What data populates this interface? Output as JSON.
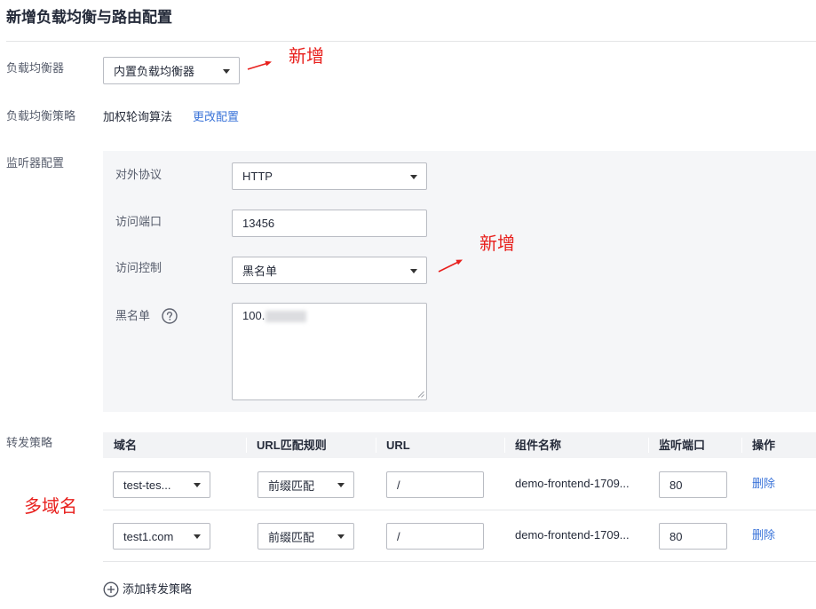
{
  "title": "新增负载均衡与路由配置",
  "load_balancer": {
    "label": "负载均衡器",
    "value": "内置负载均衡器"
  },
  "balancing_strategy": {
    "label": "负载均衡策略",
    "value": "加权轮询算法",
    "change_link": "更改配置"
  },
  "listener": {
    "label": "监听器配置",
    "protocol": {
      "label": "对外协议",
      "value": "HTTP"
    },
    "port": {
      "label": "访问端口",
      "value": "13456"
    },
    "access_control": {
      "label": "访问控制",
      "value": "黑名单"
    },
    "blacklist": {
      "label": "黑名单",
      "value": "100.",
      "help_icon": "question-circle-icon"
    }
  },
  "forwarding": {
    "label": "转发策略",
    "columns": {
      "domain": "域名",
      "match_rule": "URL匹配规则",
      "url": "URL",
      "component": "组件名称",
      "port": "监听端口",
      "action": "操作"
    },
    "rows": [
      {
        "domain": "test-tes...",
        "match_rule": "前缀匹配",
        "url": "/",
        "component": "demo-frontend-1709...",
        "port": "80",
        "action": "删除"
      },
      {
        "domain": "test1.com",
        "match_rule": "前缀匹配",
        "url": "/",
        "component": "demo-frontend-1709...",
        "port": "80",
        "action": "删除"
      }
    ],
    "add_link": "添加转发策略",
    "add_icon": "plus-circle-icon"
  },
  "annotations": {
    "load_balancer_note": "新增",
    "access_control_note": "新增",
    "forwarding_note": "多域名"
  },
  "colors": {
    "link": "#3b74d9",
    "annotation": "#e8201d",
    "panel_bg": "#f5f6f8",
    "border": "#b9bcc3",
    "label": "#575d6c",
    "text": "#252b3a"
  }
}
